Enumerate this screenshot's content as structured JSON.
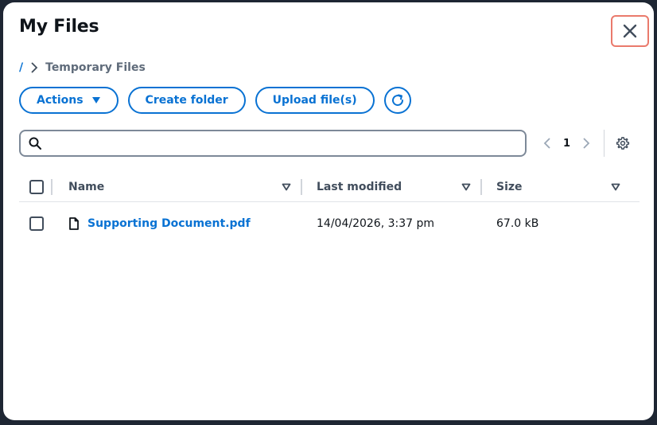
{
  "modal": {
    "title": "My Files"
  },
  "breadcrumb": {
    "root": "/",
    "current": "Temporary Files"
  },
  "toolbar": {
    "actions_label": "Actions",
    "create_folder_label": "Create folder",
    "upload_label": "Upload file(s)"
  },
  "search": {
    "value": "",
    "placeholder": ""
  },
  "pagination": {
    "current_page": "1"
  },
  "table": {
    "columns": [
      "Name",
      "Last modified",
      "Size"
    ],
    "rows": [
      {
        "name": "Supporting Document.pdf",
        "modified": "14/04/2026, 3:37 pm",
        "size": "67.0 kB"
      }
    ]
  },
  "colors": {
    "accent": "#0972d3",
    "close_highlight": "#ea7a6c",
    "background": "#1e2633"
  }
}
